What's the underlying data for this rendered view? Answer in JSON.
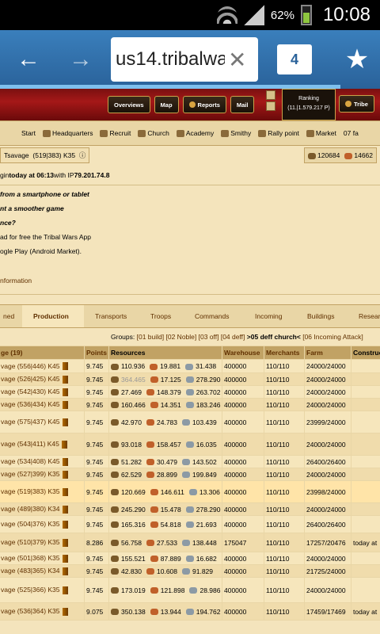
{
  "status_bar": {
    "battery_percent": "62%",
    "time": "10:08"
  },
  "browser": {
    "url": "us14.tribalwa",
    "tab_count": "4"
  },
  "game_nav": {
    "items": [
      "Overviews",
      "Map",
      "Reports",
      "Mail",
      "Tribe"
    ],
    "ranking_label": "Ranking",
    "ranking_value": "(11.|1.579.217 P)"
  },
  "building_bar": {
    "items": [
      "Start",
      "Headquarters",
      "Recruit",
      "Church",
      "Academy",
      "Smithy",
      "Rally point",
      "Market",
      "07 fa"
    ]
  },
  "village_bar": {
    "name": "Tsavage",
    "coords": "(519|383) K35",
    "wood": "120684",
    "clay": "14662"
  },
  "login_line": {
    "prefix": "gin ",
    "bold_today": "today at 06:13",
    "middle": " with IP ",
    "ip": "79.201.74.8"
  },
  "promo": {
    "l1": "from a smartphone or tablet",
    "l2": "nt a smoother game",
    "l3": "nce?",
    "l4": "ad for free the Tribal Wars App",
    "l5": "ogle Play (Android Market)."
  },
  "info_link": "nformation",
  "tabs": [
    "ned",
    "Production",
    "Transports",
    "Troops",
    "Commands",
    "Incoming",
    "Buildings",
    "Resear"
  ],
  "groups": {
    "label": "Groups:",
    "items": [
      "[01 build]",
      "[02 Noble]",
      "[03 off]",
      "[04 deff]"
    ],
    "current": ">05 deff church<",
    "tail": "[06 Incoming Attack]",
    "tail2": "[..."
  },
  "table": {
    "headers": [
      "ge (19)",
      "Points",
      "Resources",
      "Warehouse",
      "Merchants",
      "Farm",
      "Construc"
    ],
    "rows": [
      {
        "village": "vage (556|446) K45",
        "points": "9.745",
        "wood": "110.936",
        "clay": "19.881",
        "iron": "31.438",
        "wh": "400000",
        "m": "110/110",
        "farm": "24000/24000",
        "con": ""
      },
      {
        "village": "vage (526|425) K45",
        "points": "9.745",
        "wood": "364.465",
        "clay": "17.125",
        "iron": "278.290",
        "wh": "400000",
        "m": "110/110",
        "farm": "24000/24000",
        "con": ""
      },
      {
        "village": "vage (542|430) K45",
        "points": "9.745",
        "wood": "27.469",
        "clay": "148.379",
        "iron": "263.702",
        "wh": "400000",
        "m": "110/110",
        "farm": "24000/24000",
        "con": ""
      },
      {
        "village": "vage (536|434) K45",
        "points": "9.745",
        "wood": "160.466",
        "clay": "14.351",
        "iron": "183.246",
        "wh": "400000",
        "m": "110/110",
        "farm": "24000/24000",
        "con": ""
      },
      {
        "village": "vage (575|437) K45",
        "points": "9.745",
        "wood": "42.970",
        "clay": "24.783",
        "iron": "103.439",
        "wh": "400000",
        "m": "110/110",
        "farm": "23999/24000",
        "con": ""
      },
      {
        "village": "vage (543|411) K45",
        "points": "9.745",
        "wood": "93.018",
        "clay": "158.457",
        "iron": "16.035",
        "wh": "400000",
        "m": "110/110",
        "farm": "24000/24000",
        "con": ""
      },
      {
        "village": "vage (534|408) K45",
        "points": "9.745",
        "wood": "51.282",
        "clay": "30.479",
        "iron": "143.502",
        "wh": "400000",
        "m": "110/110",
        "farm": "26400/26400",
        "con": ""
      },
      {
        "village": "vage (527|399) K35",
        "points": "9.745",
        "wood": "62.529",
        "clay": "28.899",
        "iron": "199.849",
        "wh": "400000",
        "m": "110/110",
        "farm": "24000/24000",
        "con": ""
      },
      {
        "village": "vage (519|383) K35",
        "points": "9.745",
        "wood": "120.669",
        "clay": "146.611",
        "iron": "13.306",
        "wh": "400000",
        "m": "110/110",
        "farm": "23998/24000",
        "con": ""
      },
      {
        "village": "vage (489|380) K34",
        "points": "9.745",
        "wood": "245.290",
        "clay": "15.478",
        "iron": "278.290",
        "wh": "400000",
        "m": "110/110",
        "farm": "24000/24000",
        "con": ""
      },
      {
        "village": "vage (504|376) K35",
        "points": "9.745",
        "wood": "165.316",
        "clay": "54.818",
        "iron": "21.693",
        "wh": "400000",
        "m": "110/110",
        "farm": "26400/26400",
        "con": ""
      },
      {
        "village": "vage (510|379) K35",
        "points": "8.286",
        "wood": "56.758",
        "clay": "27.533",
        "iron": "138.448",
        "wh": "175047",
        "m": "110/110",
        "farm": "17257/20476",
        "con": "today at"
      },
      {
        "village": "vage (501|368) K35",
        "points": "9.745",
        "wood": "155.521",
        "clay": "87.889",
        "iron": "16.682",
        "wh": "400000",
        "m": "110/110",
        "farm": "24000/24000",
        "con": ""
      },
      {
        "village": "vage (483|365) K34",
        "points": "9.745",
        "wood": "42.830",
        "clay": "10.608",
        "iron": "91.829",
        "wh": "400000",
        "m": "110/110",
        "farm": "21725/24000",
        "con": ""
      },
      {
        "village": "vage (525|366) K35",
        "points": "9.745",
        "wood": "173.019",
        "clay": "121.898",
        "iron": "28.986",
        "wh": "400000",
        "m": "110/110",
        "farm": "24000/24000",
        "con": ""
      },
      {
        "village": "vage (536|364) K35",
        "points": "9.075",
        "wood": "350.138",
        "clay": "13.944",
        "iron": "194.762",
        "wh": "400000",
        "m": "110/110",
        "farm": "17459/17469",
        "con": "today at"
      }
    ]
  }
}
